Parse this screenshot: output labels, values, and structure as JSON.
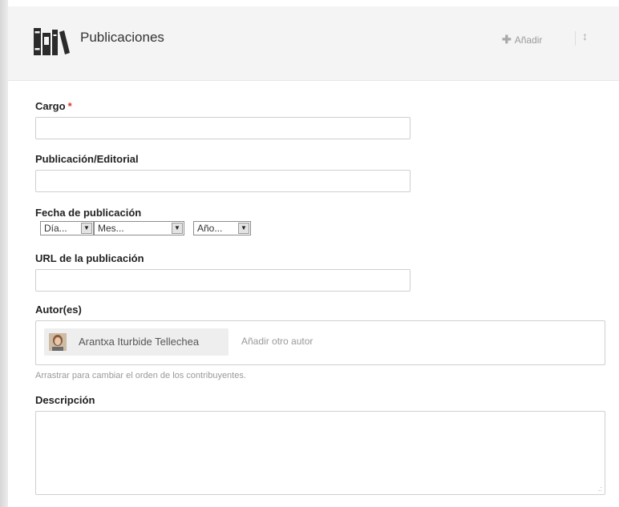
{
  "header": {
    "title": "Publicaciones",
    "add_label": "Añadir",
    "add_icon": "plus-icon",
    "reorder_icon": "updown-arrow-icon",
    "section_icon": "books-icon"
  },
  "form": {
    "cargo": {
      "label": "Cargo",
      "required_mark": "*",
      "value": ""
    },
    "publicacion": {
      "label": "Publicación/Editorial",
      "value": ""
    },
    "fecha": {
      "label": "Fecha de publicación",
      "day": "Día...",
      "month": "Mes...",
      "year": "Año..."
    },
    "url": {
      "label": "URL de la publicación",
      "value": ""
    },
    "autores": {
      "label": "Autor(es)",
      "authors": [
        {
          "name": "Arantxa Iturbide Tellechea"
        }
      ],
      "add_placeholder": "Añadir otro autor",
      "hint": "Arrastrar para cambiar el orden de los contribuyentes."
    },
    "descripcion": {
      "label": "Descripción",
      "value": ""
    }
  },
  "colors": {
    "header_bg": "#f4f4f4",
    "required": "#d9342b",
    "muted_text": "#999999",
    "border": "#cfcfcf"
  }
}
